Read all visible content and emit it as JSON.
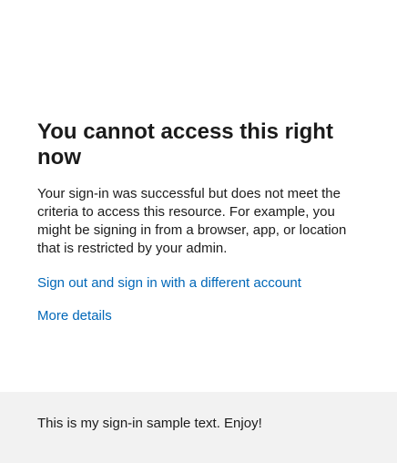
{
  "main": {
    "title": "You cannot access this right now",
    "description": "Your sign-in was successful but does not meet the criteria to access this resource. For example, you might be signing in from a browser, app, or location that is restricted by your admin.",
    "signout_link": "Sign out and sign in with a different account",
    "details_link": "More details"
  },
  "footer": {
    "text": "This is my sign-in sample text. Enjoy!"
  },
  "colors": {
    "link": "#0067b8",
    "text": "#1b1b1b",
    "footer_bg": "#f2f2f2",
    "background": "#ffffff"
  }
}
